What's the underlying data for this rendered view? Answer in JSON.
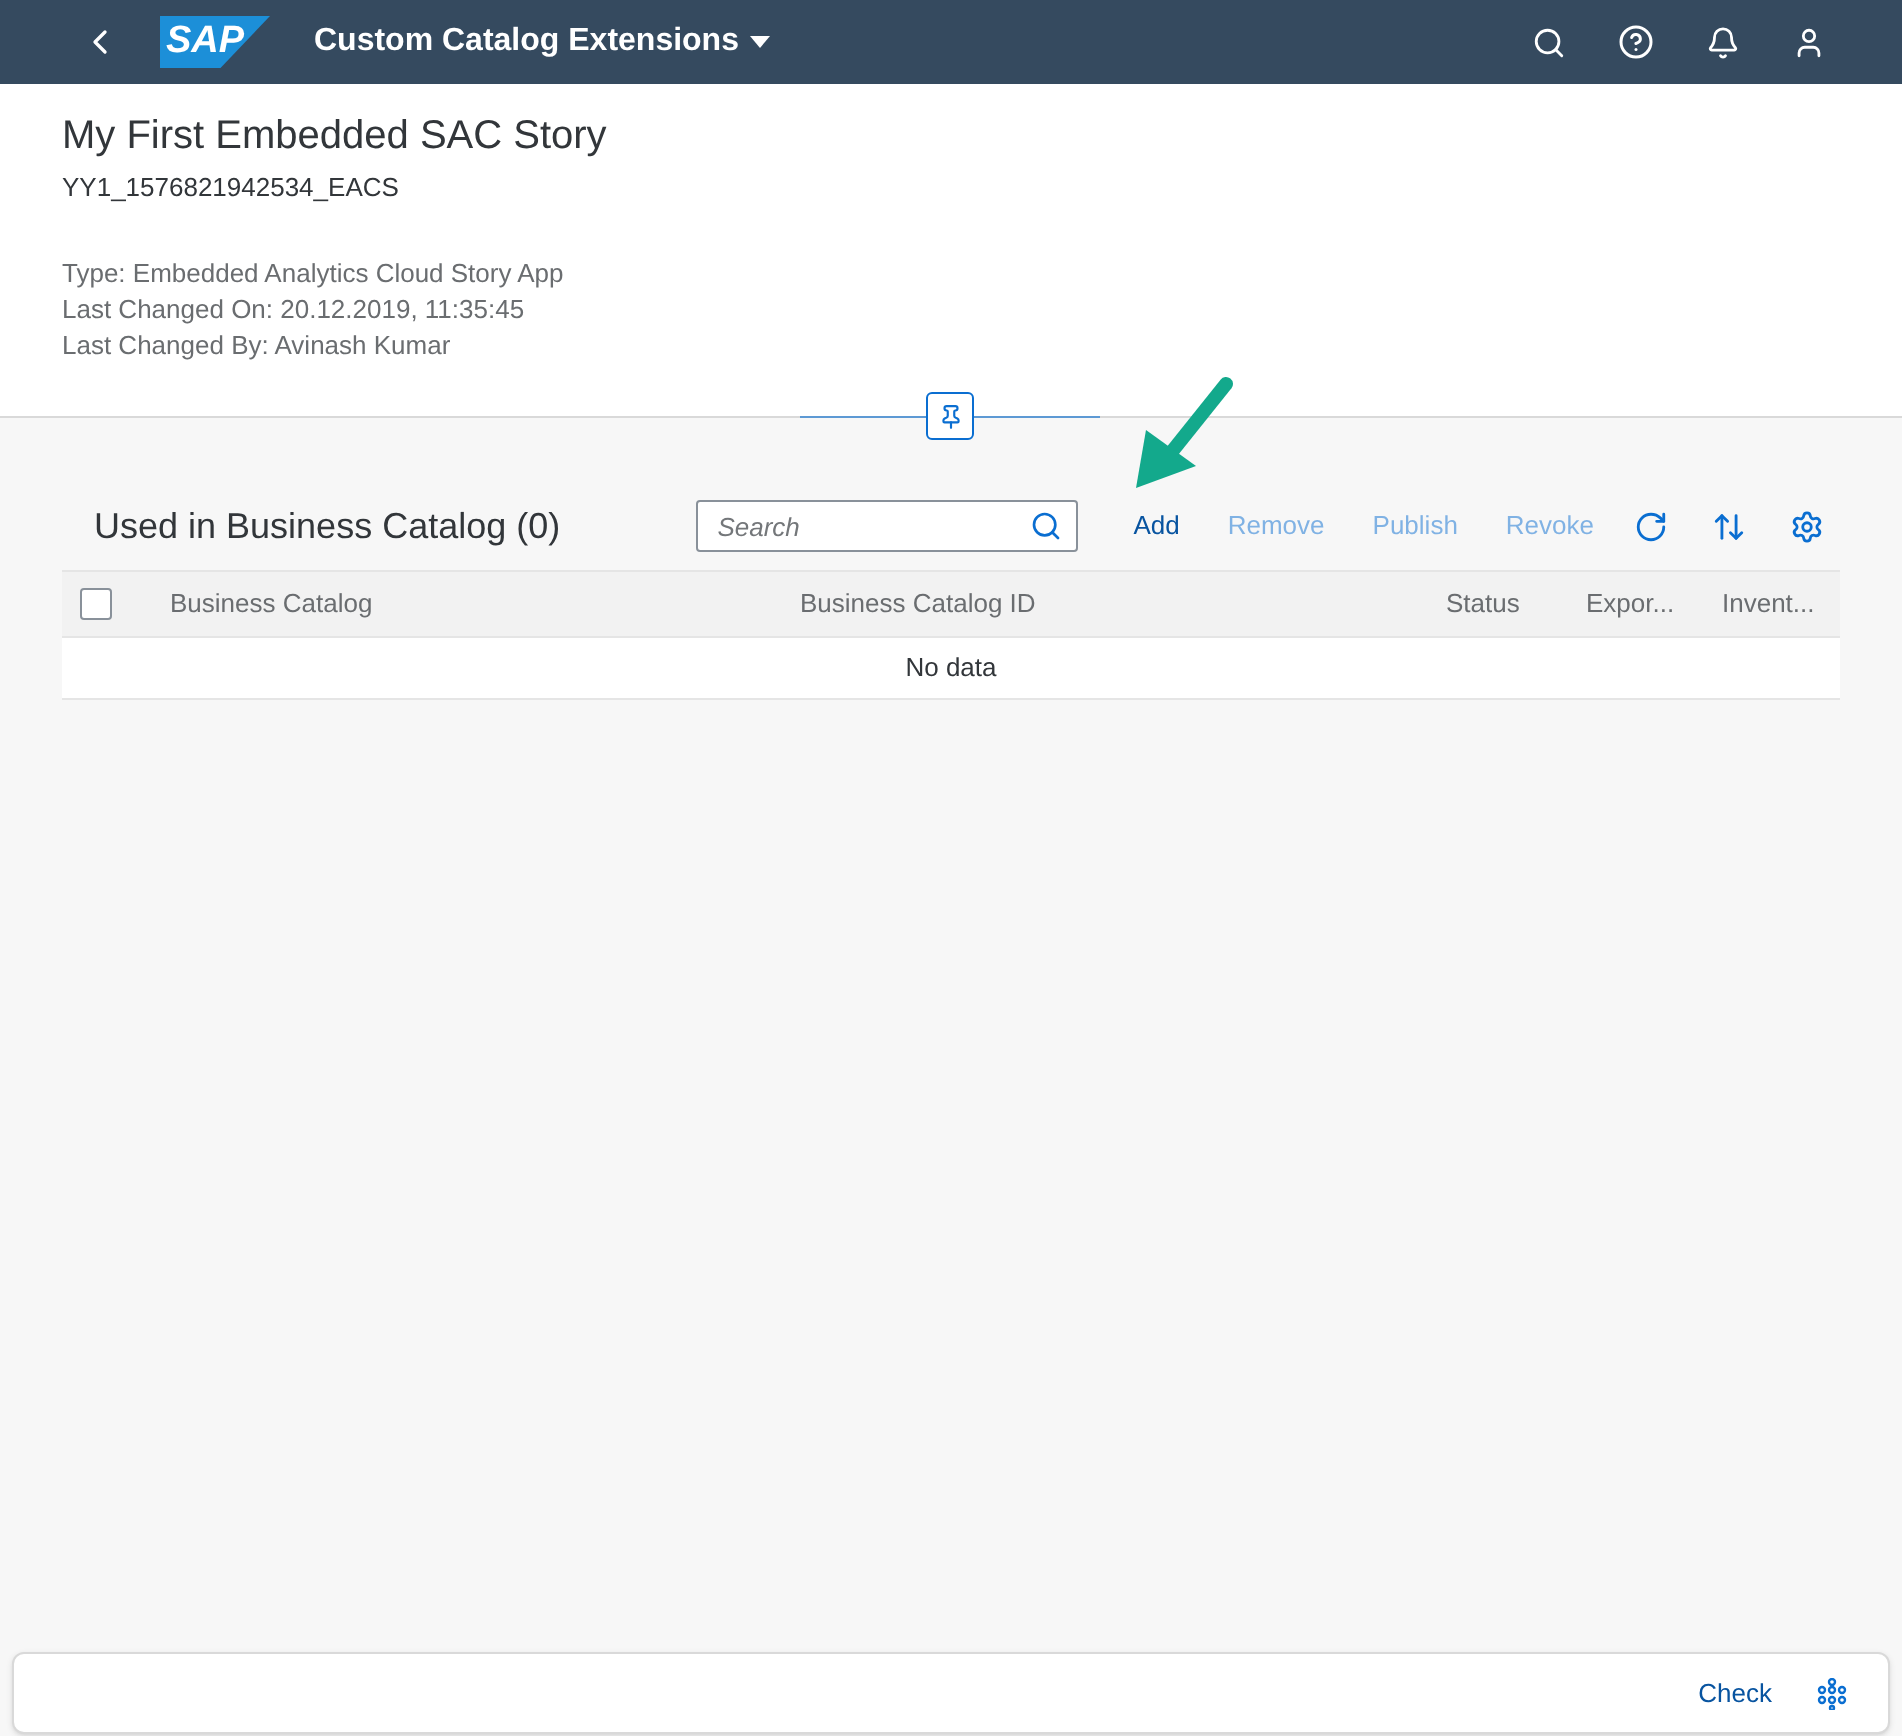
{
  "shell": {
    "logo": "SAP",
    "title": "Custom Catalog Extensions"
  },
  "header": {
    "title": "My First Embedded SAC Story",
    "subtitle": "YY1_1576821942534_EACS",
    "attributes": [
      "Type: Embedded Analytics Cloud Story App",
      "Last Changed On: 20.12.2019, 11:35:45",
      "Last Changed By: Avinash Kumar"
    ]
  },
  "table": {
    "title": "Used in Business Catalog (0)",
    "search": {
      "placeholder": "Search"
    },
    "actions": [
      {
        "label": "Add",
        "disabled": false
      },
      {
        "label": "Remove",
        "disabled": true
      },
      {
        "label": "Publish",
        "disabled": true
      },
      {
        "label": "Revoke",
        "disabled": true
      }
    ],
    "select_all": {
      "checked": false
    },
    "columns": [
      "Business Catalog",
      "Business Catalog ID",
      "Status",
      "Expor...",
      "Invent..."
    ],
    "empty_text": "No data"
  },
  "footer": {
    "buttons": [
      "Check"
    ]
  }
}
